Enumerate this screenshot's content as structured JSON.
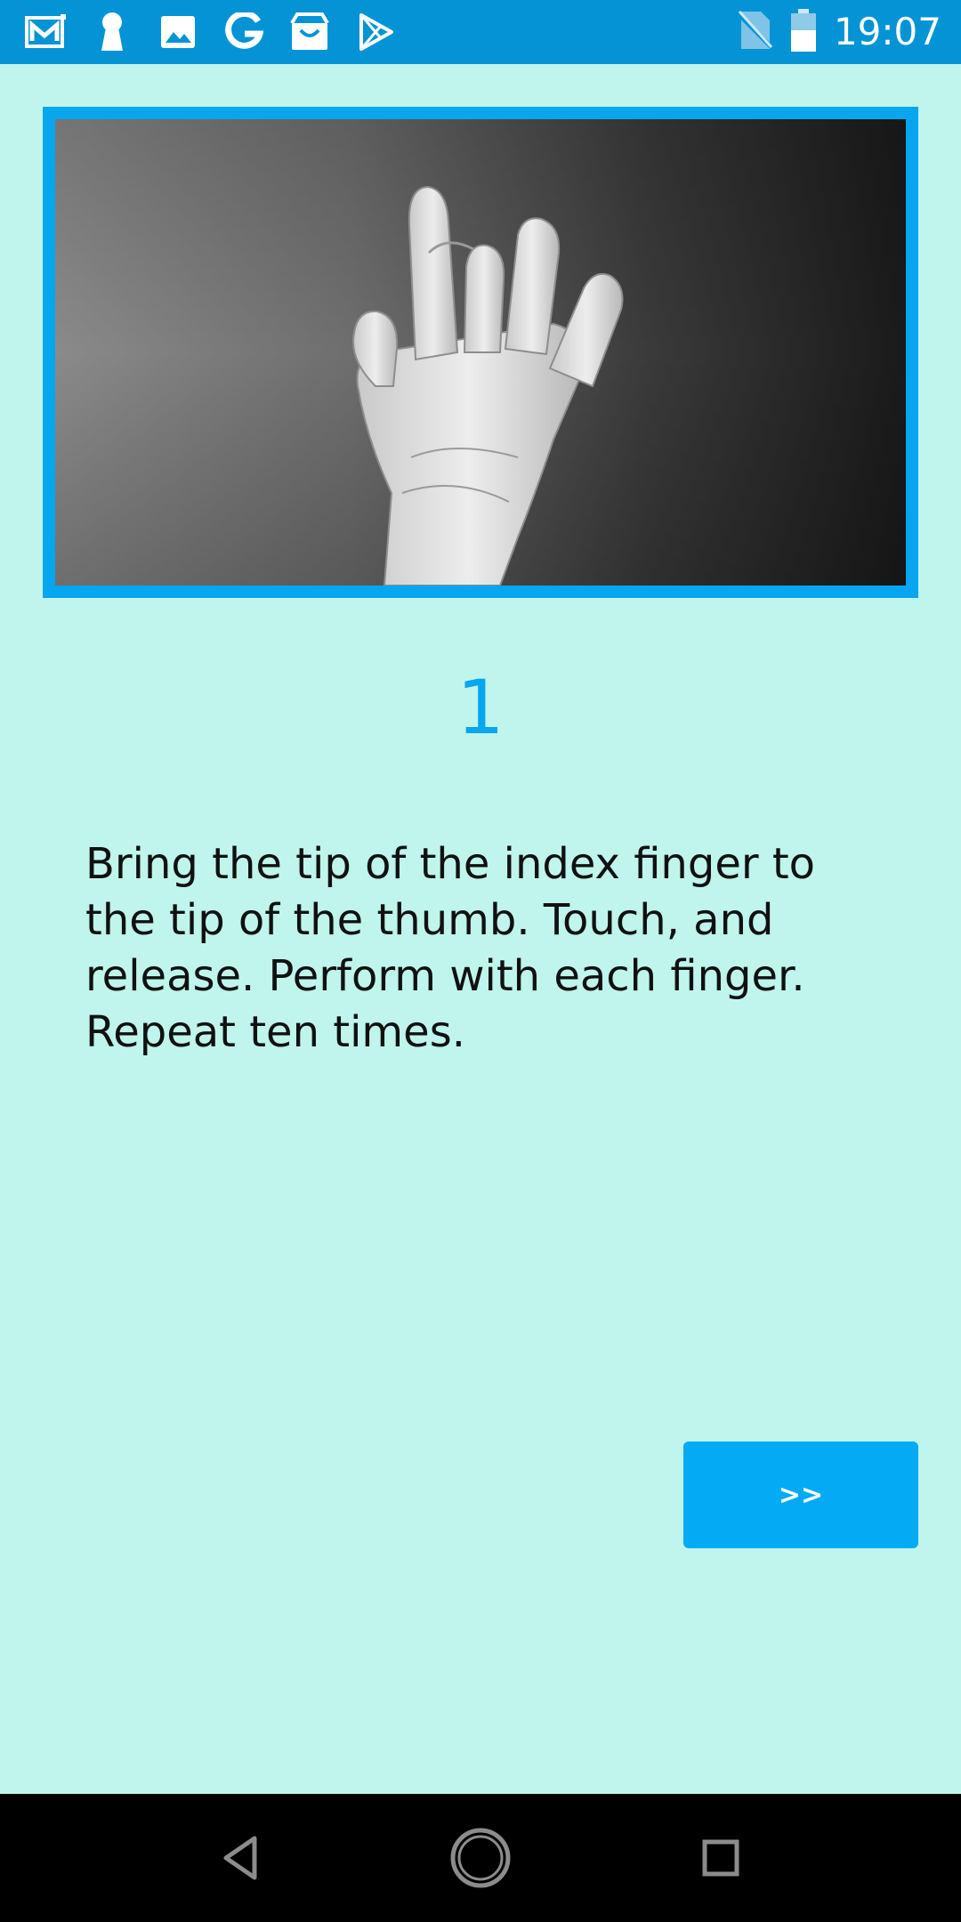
{
  "status_bar": {
    "time": "19:07",
    "notification_icons": [
      "gmail-icon",
      "keyhole-icon",
      "image-icon",
      "google-icon",
      "android-store-icon",
      "play-store-icon"
    ],
    "system_icons": [
      "no-sim-icon",
      "battery-icon"
    ],
    "background_color": "#0494d6"
  },
  "exercise": {
    "image_description_icon": "hand-exercise-image",
    "step_number": "1",
    "instruction": "Bring the tip of the index finger to the tip of the thumb. Touch, and release. Perform with each finger. Repeat ten times."
  },
  "controls": {
    "next_label": ">>"
  },
  "nav_bar": {
    "icons": [
      "back-icon",
      "home-icon",
      "recents-icon"
    ]
  },
  "colors": {
    "background": "#bff5ec",
    "accent": "#07a6ef",
    "button": "#05aaf4"
  }
}
